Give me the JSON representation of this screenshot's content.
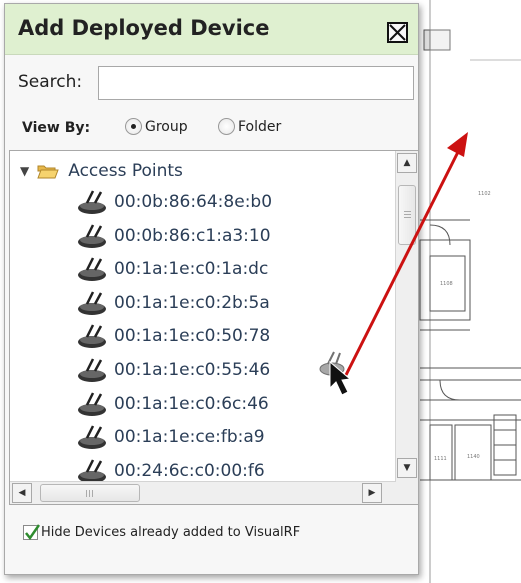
{
  "dialog": {
    "title": "Add Deployed Device",
    "close_icon": "close-x-icon"
  },
  "search": {
    "label": "Search:",
    "value": "",
    "placeholder": ""
  },
  "view_by": {
    "label": "View By:",
    "options": [
      {
        "label": "Group",
        "selected": true
      },
      {
        "label": "Folder",
        "selected": false
      }
    ]
  },
  "tree": {
    "root_label": "Access Points",
    "root_icon": "folder-open-icon",
    "expanded": true,
    "device_icon": "access-point-icon",
    "devices": [
      "00:0b:86:64:8e:b0",
      "00:0b:86:c1:a3:10",
      "00:1a:1e:c0:1a:dc",
      "00:1a:1e:c0:2b:5a",
      "00:1a:1e:c0:50:78",
      "00:1a:1e:c0:55:46",
      "00:1a:1e:c0:6c:46",
      "00:1a:1e:ce:fb:a9",
      "00:24:6c:c0:00:f6"
    ]
  },
  "hide_devices": {
    "label": "Hide Devices already added to VisualRF",
    "checked": true
  },
  "colors": {
    "titlebar_bg": "#dff0d0",
    "device_text": "#2b3e57",
    "arrow": "#cc1111",
    "checkmark": "#2e8b2e"
  }
}
